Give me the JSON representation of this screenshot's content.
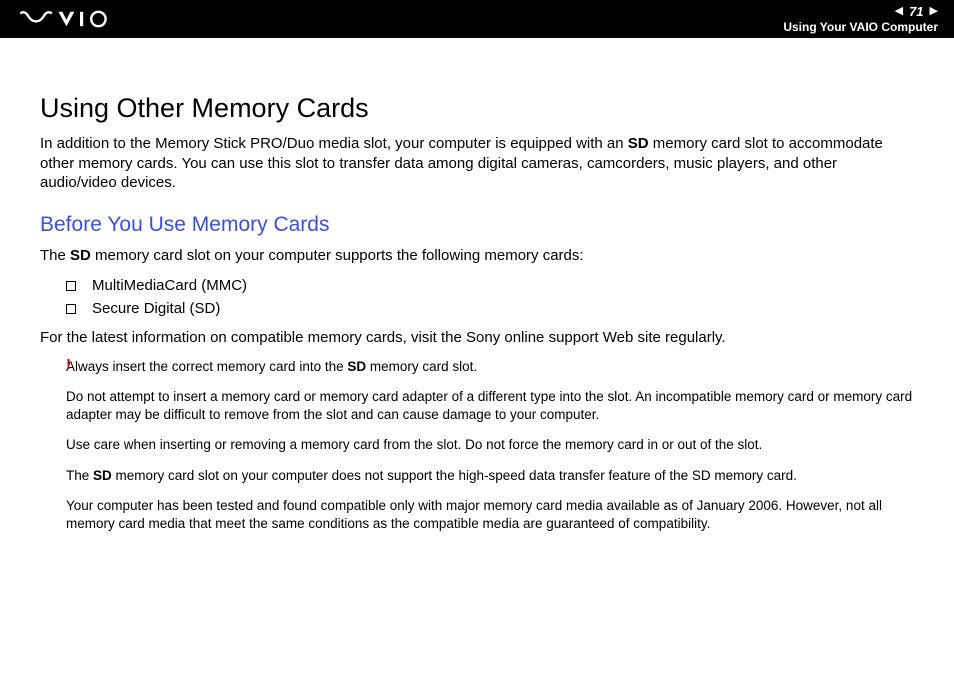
{
  "header": {
    "page_number": "71",
    "section": "Using Your VAIO Computer"
  },
  "title": "Using Other Memory Cards",
  "intro_pre": "In addition to the Memory Stick PRO/Duo media slot, your computer is equipped with an ",
  "intro_bold": "SD",
  "intro_post": " memory card slot to accommodate other memory cards. You can use this slot to transfer data among digital cameras, camcorders, music players, and other audio/video devices.",
  "subtitle": "Before You Use Memory Cards",
  "support_pre": "The ",
  "support_bold": "SD",
  "support_post": " memory card slot on your computer supports the following memory cards:",
  "bullets": [
    "MultiMediaCard (MMC)",
    "Secure Digital (SD)"
  ],
  "latest_info": "For the latest information on compatible memory cards, visit the Sony online support Web site regularly.",
  "exclaim": "!",
  "warn1_pre": "Always insert the correct memory card into the ",
  "warn1_bold": "SD",
  "warn1_post": " memory card slot.",
  "warn2": "Do not attempt to insert a memory card or memory card adapter of a different type into the slot. An incompatible memory card or memory card adapter may be difficult to remove from the slot and can cause damage to your computer.",
  "warn3": "Use care when inserting or removing a memory card from the slot. Do not force the memory card in or out of the slot.",
  "warn4_pre": "The ",
  "warn4_bold": "SD",
  "warn4_post": " memory card slot on your computer does not support the high-speed data transfer feature of the SD memory card.",
  "warn5": "Your computer has been tested and found compatible only with major memory card media available as of January 2006. However, not all memory card media that meet the same conditions as the compatible media are guaranteed of compatibility."
}
